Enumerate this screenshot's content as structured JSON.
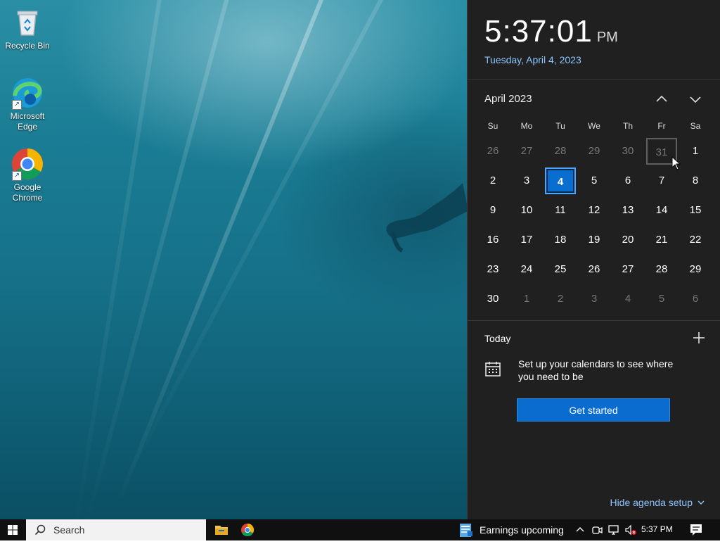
{
  "desktop": {
    "icons": [
      {
        "label": "Recycle Bin"
      },
      {
        "label": "Microsoft Edge"
      },
      {
        "label": "Google Chrome"
      }
    ]
  },
  "flyout": {
    "time": "5:37:01",
    "ampm": "PM",
    "date": "Tuesday, April 4, 2023",
    "month_label": "April 2023",
    "weekdays": [
      "Su",
      "Mo",
      "Tu",
      "We",
      "Th",
      "Fr",
      "Sa"
    ],
    "weeks": [
      [
        {
          "d": "26",
          "other": true
        },
        {
          "d": "27",
          "other": true
        },
        {
          "d": "28",
          "other": true
        },
        {
          "d": "29",
          "other": true
        },
        {
          "d": "30",
          "other": true
        },
        {
          "d": "31",
          "other": true
        },
        {
          "d": "1"
        }
      ],
      [
        {
          "d": "2"
        },
        {
          "d": "3"
        },
        {
          "d": "4",
          "today": true
        },
        {
          "d": "5"
        },
        {
          "d": "6"
        },
        {
          "d": "7"
        },
        {
          "d": "8"
        }
      ],
      [
        {
          "d": "9"
        },
        {
          "d": "10"
        },
        {
          "d": "11"
        },
        {
          "d": "12"
        },
        {
          "d": "13"
        },
        {
          "d": "14"
        },
        {
          "d": "15"
        }
      ],
      [
        {
          "d": "16"
        },
        {
          "d": "17"
        },
        {
          "d": "18"
        },
        {
          "d": "19"
        },
        {
          "d": "20"
        },
        {
          "d": "21"
        },
        {
          "d": "22"
        }
      ],
      [
        {
          "d": "23"
        },
        {
          "d": "24"
        },
        {
          "d": "25"
        },
        {
          "d": "26"
        },
        {
          "d": "27"
        },
        {
          "d": "28"
        },
        {
          "d": "29"
        }
      ],
      [
        {
          "d": "30"
        },
        {
          "d": "1",
          "other": true
        },
        {
          "d": "2",
          "other": true
        },
        {
          "d": "3",
          "other": true
        },
        {
          "d": "4",
          "other": true
        },
        {
          "d": "5",
          "other": true
        },
        {
          "d": "6",
          "other": true
        }
      ]
    ],
    "hovered_day": "31",
    "agenda": {
      "title": "Today",
      "message": "Set up your calendars to see where you need to be",
      "button": "Get started",
      "hide_link": "Hide agenda setup"
    }
  },
  "taskbar": {
    "search_placeholder": "Search",
    "news_text": "Earnings upcoming",
    "clock": "5:37 PM",
    "tray_icons": [
      "chevron-up-icon",
      "meet-now-icon",
      "network-icon",
      "volume-muted-icon"
    ]
  },
  "colors": {
    "accent": "#0b6cd0",
    "link": "#8ec5ff",
    "flyout_bg": "#202020"
  }
}
